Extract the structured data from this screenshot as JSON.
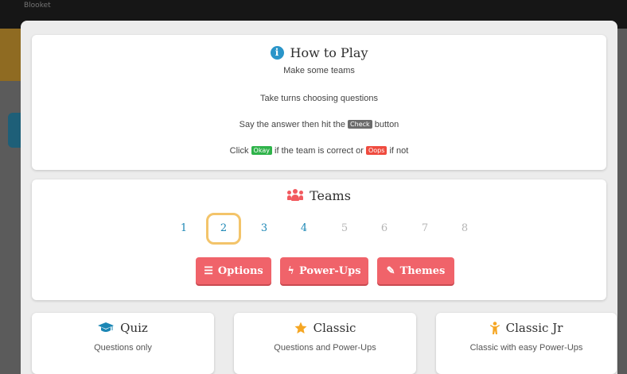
{
  "background": {
    "app_title": "Blooket"
  },
  "how_to_play": {
    "title": "How to Play",
    "steps": {
      "s1": "Make some teams",
      "s2": "Take turns choosing questions",
      "s3_before": "Say the answer then hit the",
      "s3_badge": "Check",
      "s3_after": "button",
      "s4_before": "Click",
      "s4_badge1": "Okay",
      "s4_middle": "if the team is correct or",
      "s4_badge2": "Oops",
      "s4_after": "if not"
    }
  },
  "teams": {
    "title": "Teams",
    "numbers": [
      "1",
      "2",
      "3",
      "4",
      "5",
      "6",
      "7",
      "8"
    ],
    "selected": "2",
    "buttons": {
      "options": "Options",
      "powerups": "Power-Ups",
      "themes": "Themes"
    }
  },
  "modes": [
    {
      "title": "Quiz",
      "desc": "Questions only",
      "icon": "graduation-cap-icon"
    },
    {
      "title": "Classic",
      "desc": "Questions and Power-Ups",
      "icon": "star-icon"
    },
    {
      "title": "Classic Jr",
      "desc": "Classic with easy Power-Ups",
      "icon": "child-icon"
    }
  ],
  "colors": {
    "accent_red": "#f0636a",
    "link_blue": "#1c87b5",
    "selected_ring": "#f3c46a",
    "okay_green": "#2fb34a",
    "oops_red": "#ef4b3f",
    "star_orange": "#f5a623"
  }
}
